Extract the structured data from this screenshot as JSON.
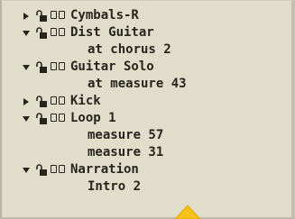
{
  "tracks": [
    {
      "label": "Cymbals-R",
      "expanded": false
    },
    {
      "label": "Dist Guitar",
      "expanded": true,
      "children": [
        "at chorus 2"
      ]
    },
    {
      "label": "Guitar Solo",
      "expanded": true,
      "children": [
        "at measure 43"
      ]
    },
    {
      "label": "Kick",
      "expanded": false
    },
    {
      "label": "Loop 1",
      "expanded": true,
      "children": [
        "measure 57",
        "measure 31"
      ]
    },
    {
      "label": "Narration",
      "expanded": true,
      "children": [
        "Intro 2"
      ]
    }
  ],
  "colors": {
    "panel_bg": "#e1ddcb",
    "text": "#26251d",
    "pointer": "#f6c21a"
  }
}
